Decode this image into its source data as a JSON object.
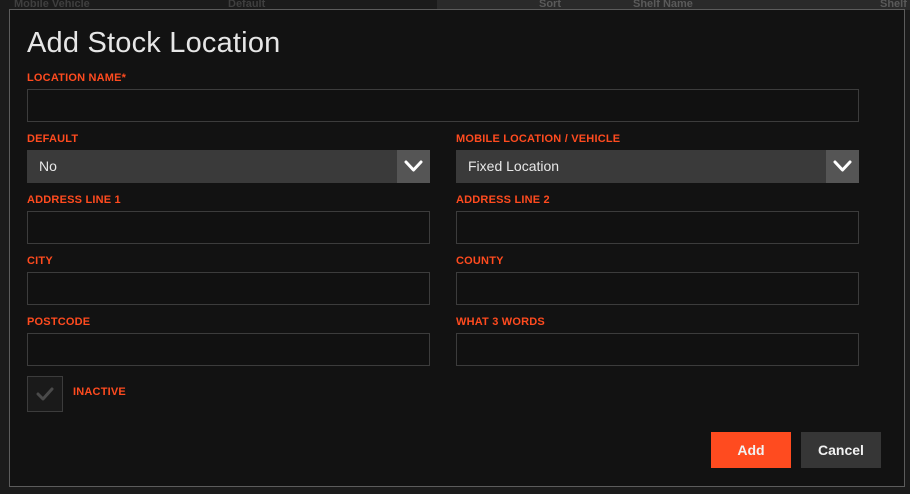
{
  "background": {
    "columns": [
      "Mobile Vehicle",
      "Default",
      "Sort",
      "Shelf Name",
      "Shelf"
    ]
  },
  "dialog": {
    "title": "Add Stock Location",
    "fields": {
      "location_name": {
        "label": "LOCATION NAME*",
        "value": "",
        "placeholder": ""
      },
      "default": {
        "label": "DEFAULT",
        "value": "No"
      },
      "mobile_location": {
        "label": "MOBILE LOCATION / VEHICLE",
        "value": "Fixed Location"
      },
      "address_line_1": {
        "label": "ADDRESS LINE 1",
        "value": ""
      },
      "address_line_2": {
        "label": "ADDRESS LINE 2",
        "value": ""
      },
      "city": {
        "label": "CITY",
        "value": ""
      },
      "county": {
        "label": "COUNTY",
        "value": ""
      },
      "postcode": {
        "label": "POSTCODE",
        "value": ""
      },
      "what3words": {
        "label": "WHAT 3 WORDS",
        "value": ""
      },
      "inactive": {
        "label": "INACTIVE",
        "checked": false
      }
    },
    "buttons": {
      "add": "Add",
      "cancel": "Cancel"
    },
    "colors": {
      "accent": "#ff4b1f",
      "label": "#ff4b1f",
      "select_bg": "#3a3a3a",
      "arrow_bg": "#555555"
    }
  }
}
